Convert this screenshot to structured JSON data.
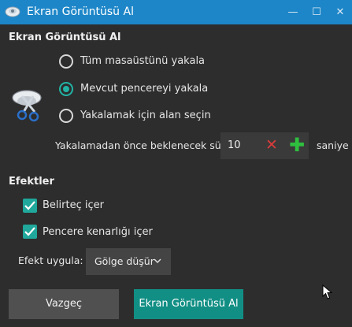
{
  "window": {
    "title": "Ekran Görüntüsü Al",
    "icon": "camera-app-icon",
    "controls": {
      "minimize": "—",
      "maximize": "☐",
      "close": "✕"
    }
  },
  "capture": {
    "heading": "Ekran Görüntüsü Al",
    "options": [
      {
        "label": "Tüm masaüstünü yakala",
        "selected": false
      },
      {
        "label": "Mevcut pencereyi yakala",
        "selected": true
      },
      {
        "label": "Yakalamak için alan seçin",
        "selected": false
      }
    ],
    "delay": {
      "label": "Yakalamadan önce beklenecek süre",
      "value": "10",
      "unit": "saniye",
      "clear_icon": "✕",
      "increment_icon": "✚"
    }
  },
  "effects": {
    "heading": "Efektler",
    "checkboxes": [
      {
        "label": "Belirteç içer",
        "checked": true
      },
      {
        "label": "Pencere kenarlığı içer",
        "checked": true
      }
    ],
    "apply_label": "Efekt uygula:",
    "apply_value": "Gölge düşür"
  },
  "buttons": {
    "cancel": "Vazgeç",
    "confirm": "Ekran Görüntüsü Al"
  },
  "colors": {
    "titlebar": "#1d86c8",
    "accent": "#22b3a5",
    "primary_button": "#128f85",
    "clear": "#d83b3b",
    "increment": "#2fbf3f"
  }
}
